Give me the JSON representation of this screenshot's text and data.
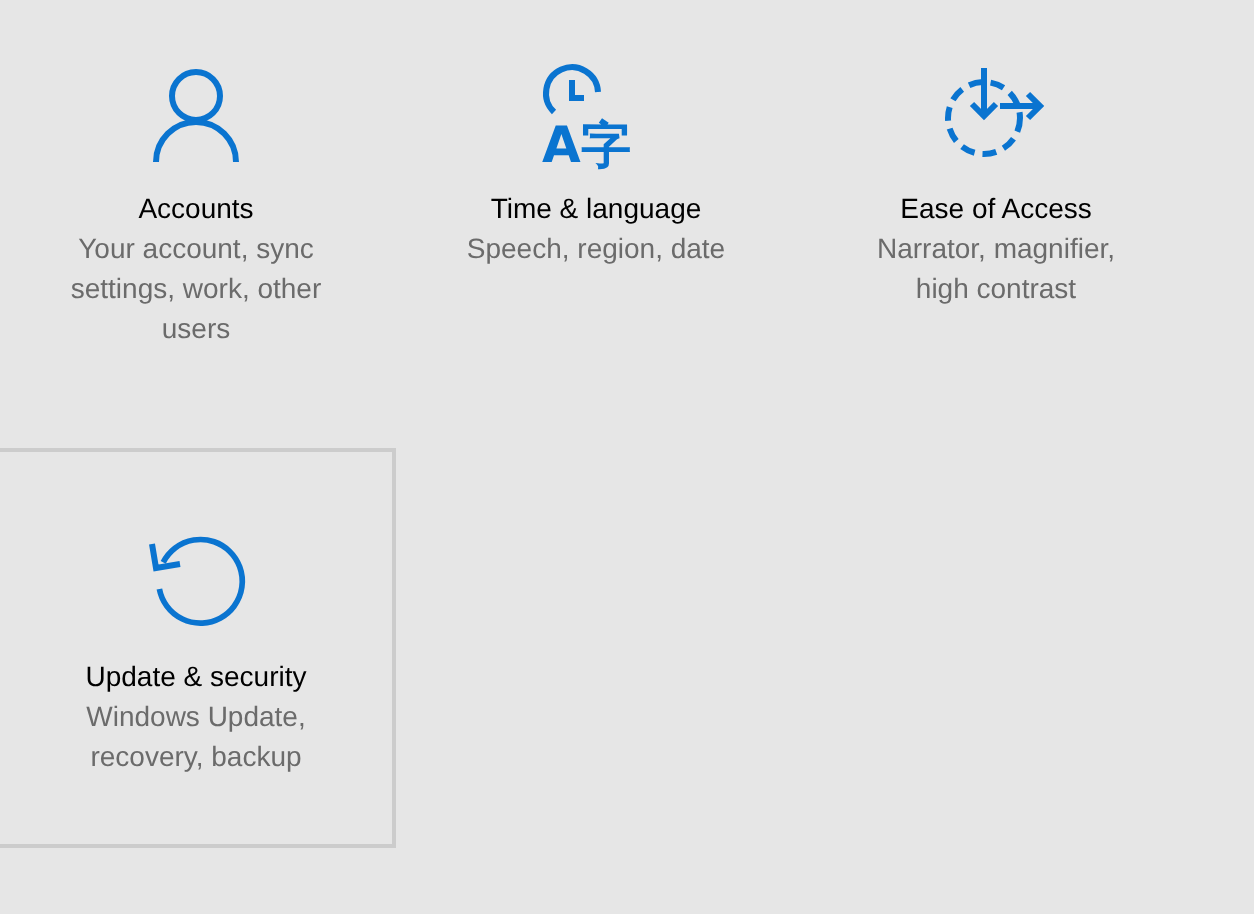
{
  "tiles": [
    {
      "kind": "person",
      "title": "Accounts",
      "description": "Your account, sync settings, work, other users",
      "selected": false
    },
    {
      "kind": "time-language",
      "icon_text": "A字",
      "title": "Time & language",
      "description": "Speech, region, date",
      "selected": false
    },
    {
      "kind": "ease",
      "title": "Ease of Access",
      "description": "Narrator, magnifier, high contrast",
      "selected": false
    },
    {
      "kind": "update",
      "title": "Update & security",
      "description": "Windows Update, recovery, backup",
      "selected": true
    }
  ]
}
